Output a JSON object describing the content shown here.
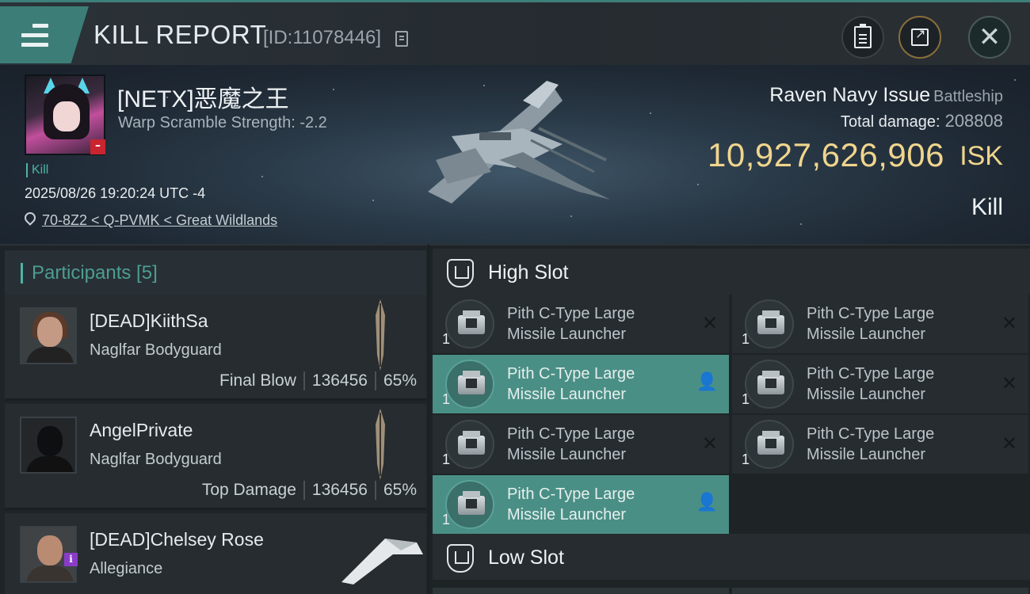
{
  "header": {
    "title": "KILL REPORT",
    "id_text": "[ID:11078446]"
  },
  "victim": {
    "name": "[NETX]恶魔之王",
    "warp_scramble": "Warp Scramble Strength: -2.2",
    "tag": "Kill",
    "timestamp": "2025/08/26 19:20:24 UTC -4",
    "location": "70-8Z2 < Q-PVMK < Great Wildlands",
    "ship_name": "Raven Navy Issue",
    "ship_class": "Battleship",
    "total_damage_label": "Total damage:",
    "total_damage": "208808",
    "isk_value": "10,927,626,906",
    "isk_unit": "ISK",
    "result": "Kill"
  },
  "participants": {
    "title": "Participants [5]",
    "items": [
      {
        "name": "[DEAD]KiithSa",
        "ship": "Naglfar Bodyguard",
        "role": "Final Blow",
        "damage": "136456",
        "percent": "65%"
      },
      {
        "name": "AngelPrivate",
        "ship": "Naglfar Bodyguard",
        "role": "Top Damage",
        "damage": "136456",
        "percent": "65%"
      },
      {
        "name": "[DEAD]Chelsey Rose",
        "ship": "Allegiance"
      }
    ]
  },
  "fitting": {
    "high_slot_title": "High Slot",
    "low_slot_title": "Low Slot",
    "modules": [
      {
        "line1": "Pith C-Type Large",
        "line2": "Missile Launcher",
        "qty": "1",
        "status": "destroyed"
      },
      {
        "line1": "Pith C-Type Large",
        "line2": "Missile Launcher",
        "qty": "1",
        "status": "destroyed"
      },
      {
        "line1": "Pith C-Type Large",
        "line2": "Missile Launcher",
        "qty": "1",
        "status": "dropped"
      },
      {
        "line1": "Pith C-Type Large",
        "line2": "Missile Launcher",
        "qty": "1",
        "status": "destroyed"
      },
      {
        "line1": "Pith C-Type Large",
        "line2": "Missile Launcher",
        "qty": "1",
        "status": "destroyed"
      },
      {
        "line1": "Pith C-Type Large",
        "line2": "Missile Launcher",
        "qty": "1",
        "status": "destroyed"
      },
      {
        "line1": "Pith C-Type Large",
        "line2": "Missile Launcher",
        "qty": "1",
        "status": "dropped"
      }
    ]
  },
  "colors": {
    "accent": "#4a8f85",
    "isk": "#f0d58d",
    "kill_tag": "#4fb3a6"
  }
}
